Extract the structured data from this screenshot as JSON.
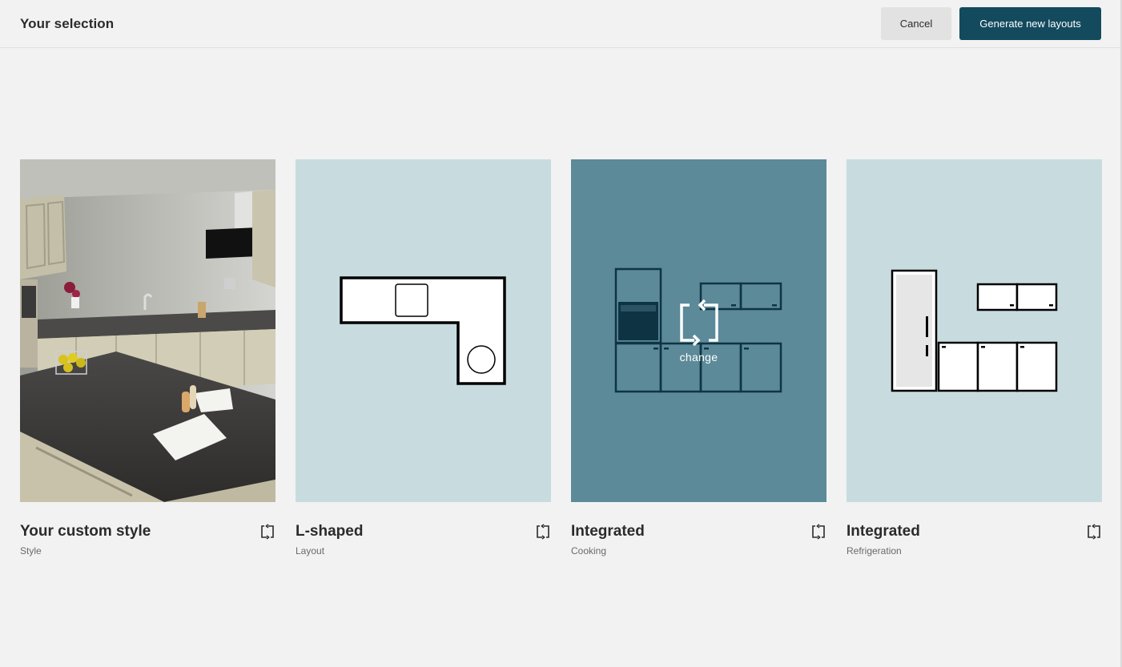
{
  "header": {
    "title": "Your selection",
    "cancel_label": "Cancel",
    "generate_label": "Generate new layouts"
  },
  "cards": [
    {
      "title": "Your custom style",
      "subtitle": "Style",
      "image": "kitchen-photo"
    },
    {
      "title": "L-shaped",
      "subtitle": "Layout",
      "image": "l-shaped-floorplan-icon"
    },
    {
      "title": "Integrated",
      "subtitle": "Cooking",
      "image": "integrated-cooking-icon",
      "hover_label": "change"
    },
    {
      "title": "Integrated",
      "subtitle": "Refrigeration",
      "image": "integrated-refrigeration-icon"
    }
  ],
  "colors": {
    "primary": "#134a5e",
    "tile_light": "#c8dce0",
    "tile_hover": "#5c8a99",
    "background": "#f2f2f2"
  }
}
